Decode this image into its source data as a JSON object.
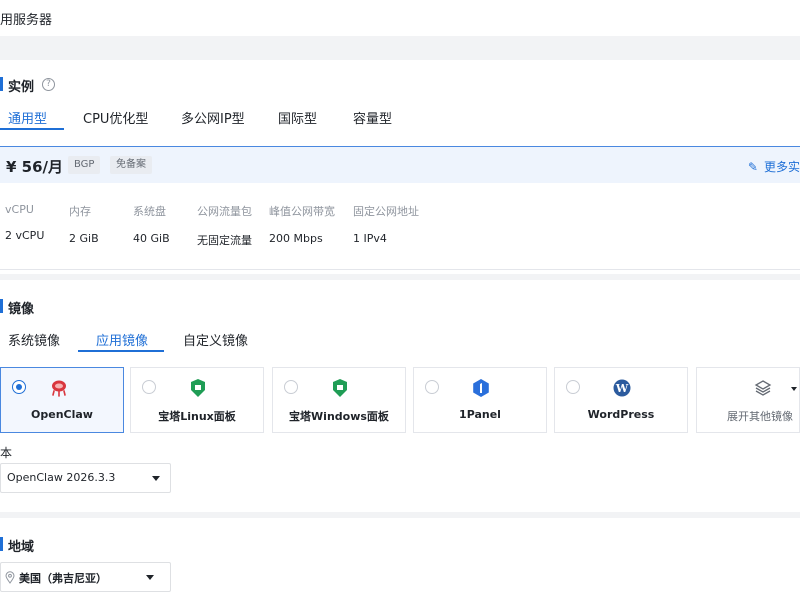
{
  "header": {
    "title": "用服务器"
  },
  "instance": {
    "section_title": "实例",
    "help_icon": "question-circle-icon",
    "tabs": [
      {
        "label": "通用型",
        "active": true
      },
      {
        "label": "CPU优化型",
        "active": false
      },
      {
        "label": "多公网IP型",
        "active": false
      },
      {
        "label": "国际型",
        "active": false
      },
      {
        "label": "容量型",
        "active": false
      }
    ],
    "plan": {
      "price": "¥ 56/月",
      "tags": [
        "BGP",
        "免备案"
      ],
      "more_link": "更多实",
      "more_icon": "edit-pencil-icon",
      "specs": [
        {
          "label": "vCPU",
          "value": "2 vCPU"
        },
        {
          "label": "内存",
          "value": "2 GiB"
        },
        {
          "label": "系统盘",
          "value": "40 GiB"
        },
        {
          "label": "公网流量包",
          "value": "无固定流量"
        },
        {
          "label": "峰值公网带宽",
          "value": "200 Mbps"
        },
        {
          "label": "固定公网地址",
          "value": "1 IPv4"
        }
      ]
    }
  },
  "image": {
    "section_title": "镜像",
    "tabs": [
      {
        "label": "系统镜像",
        "active": false
      },
      {
        "label": "应用镜像",
        "active": true
      },
      {
        "label": "自定义镜像",
        "active": false
      }
    ],
    "cards": [
      {
        "name": "OpenClaw",
        "icon": "openclaw-icon",
        "selected": true
      },
      {
        "name": "宝塔Linux面板",
        "icon": "baota-icon",
        "selected": false
      },
      {
        "name": "宝塔Windows面板",
        "icon": "baota-icon",
        "selected": false
      },
      {
        "name": "1Panel",
        "icon": "1panel-icon",
        "selected": false
      },
      {
        "name": "WordPress",
        "icon": "wordpress-icon",
        "selected": false
      },
      {
        "name": "展开其他镜像",
        "icon": "layers-icon",
        "selected": false
      }
    ],
    "version_label": "本",
    "version_value": "OpenClaw 2026.3.3"
  },
  "region": {
    "section_title": "地域",
    "value": "美国（弗吉尼亚）",
    "icon": "location-pin-icon"
  },
  "colors": {
    "accent": "#1f6fd6",
    "spec_header_bg": "#eef4fd",
    "page_bg": "#f2f3f5"
  }
}
